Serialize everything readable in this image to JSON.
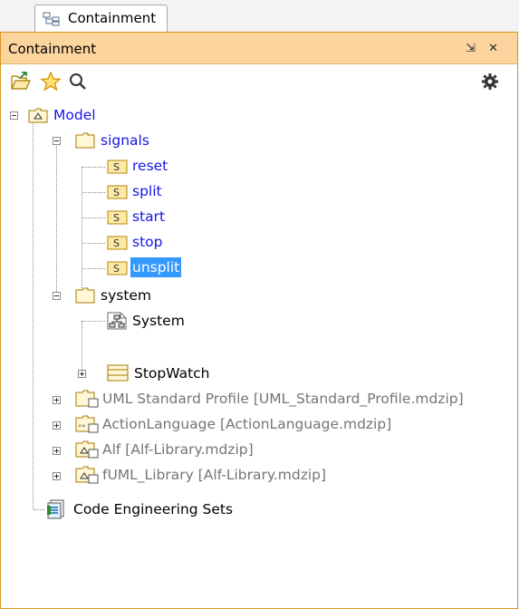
{
  "tab": {
    "label": "Containment"
  },
  "panel": {
    "title": "Containment",
    "window_buttons": "⇲ ✕"
  },
  "toolbar": {
    "icons": [
      "open-icon",
      "star-icon",
      "search-icon",
      "gear-icon"
    ]
  },
  "tree": {
    "model": "Model",
    "signals": "signals",
    "signal_items": [
      "reset",
      "split",
      "start",
      "stop",
      "unsplit"
    ],
    "system": "system",
    "system_items": [
      "System",
      "StopWatch"
    ],
    "libraries": [
      "UML Standard Profile [UML_Standard_Profile.mdzip]",
      "ActionLanguage [ActionLanguage.mdzip]",
      "Alf [Alf-Library.mdzip]",
      "fUML_Library [Alf-Library.mdzip]"
    ],
    "code_engineering": "Code Engineering Sets",
    "selected": "unsplit"
  },
  "colors": {
    "title_bar": "#fcd59e",
    "selection": "#3399ff",
    "link_text": "#1515e6",
    "muted_text": "#757575"
  }
}
